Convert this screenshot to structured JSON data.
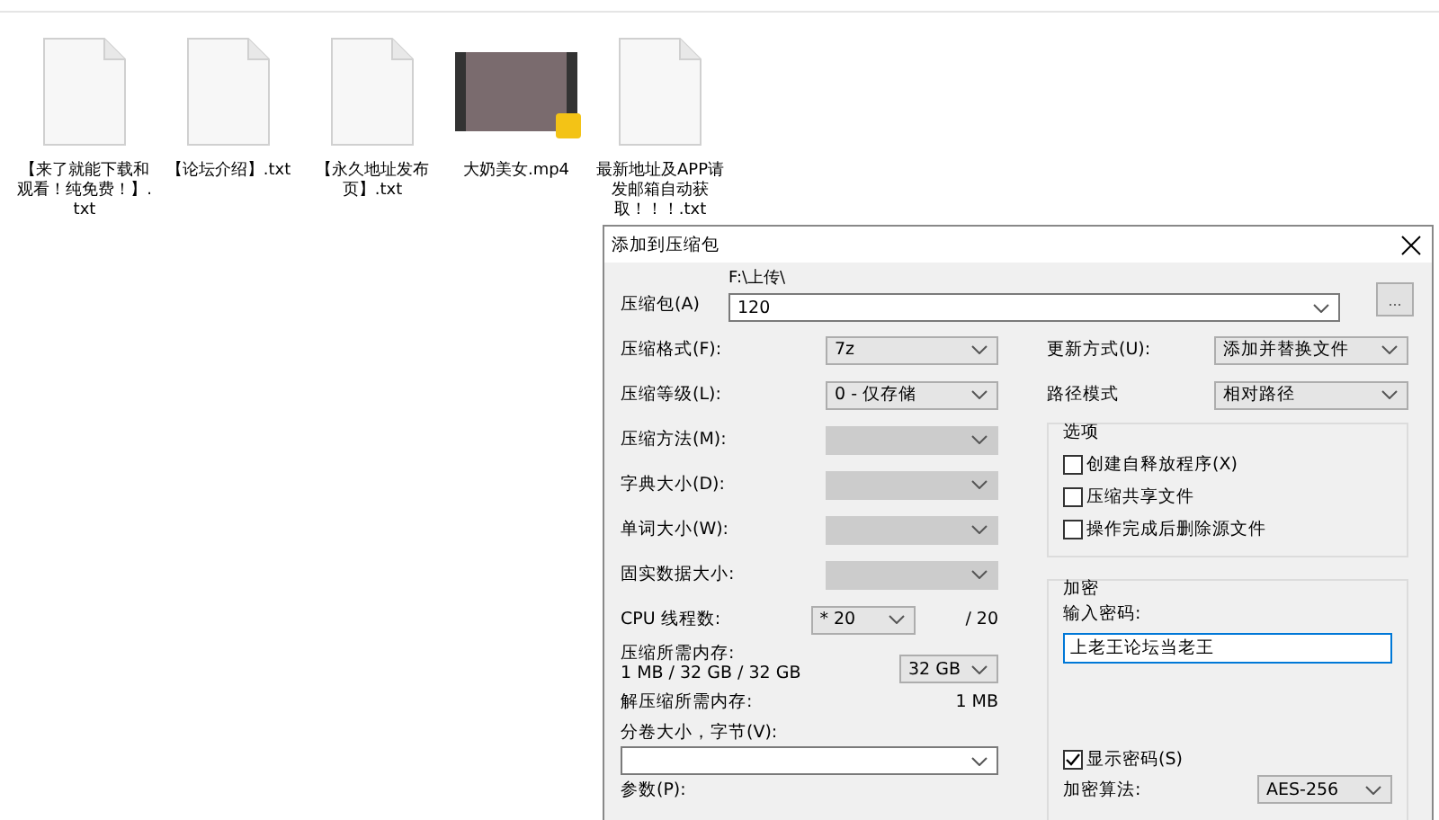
{
  "files": [
    {
      "name": "【来了就能下载和观看！纯免费！】.txt",
      "kind": "text"
    },
    {
      "name": "【论坛介绍】.txt",
      "kind": "text"
    },
    {
      "name": "【永久地址发布页】.txt",
      "kind": "text"
    },
    {
      "name": "大奶美女.mp4",
      "kind": "video"
    },
    {
      "name": "最新地址及APP请发邮箱自动获取！！！.txt",
      "kind": "text"
    }
  ],
  "dialog": {
    "title": "添加到压缩包",
    "archive": {
      "label": "压缩包(A)",
      "path": "F:\\上传\\",
      "value": "120",
      "browse": "..."
    },
    "left_rows": [
      {
        "label": "压缩格式(F):",
        "value": "7z",
        "disabled": false
      },
      {
        "label": "压缩等级(L):",
        "value": "0 - 仅存储",
        "disabled": false
      },
      {
        "label": "压缩方法(M):",
        "disabled": true
      },
      {
        "label": "字典大小(D):",
        "disabled": true
      },
      {
        "label": "单词大小(W):",
        "disabled": true
      },
      {
        "label": "固实数据大小:",
        "disabled": true
      }
    ],
    "cpu": {
      "label": "CPU 线程数:",
      "value": "* 20",
      "total": "/ 20"
    },
    "memory": {
      "label": "压缩所需内存:",
      "detail": "1 MB / 32 GB / 32 GB",
      "value": "32 GB"
    },
    "decompress": {
      "label": "解压缩所需内存:",
      "value": "1 MB"
    },
    "volume": {
      "label": "分卷大小，字节(V):"
    },
    "params": {
      "label": "参数(P):"
    },
    "right_rows": [
      {
        "label": "更新方式(U):",
        "value": "添加并替换文件"
      },
      {
        "label": "路径模式",
        "value": "相对路径"
      }
    ],
    "options": {
      "title": "选项",
      "items": [
        {
          "label": "创建自释放程序(X)",
          "checked": false
        },
        {
          "label": "压缩共享文件",
          "checked": false
        },
        {
          "label": "操作完成后删除源文件",
          "checked": false
        }
      ]
    },
    "encryption": {
      "title": "加密",
      "password_label": "输入密码:",
      "password": "上老王论坛当老王",
      "show_password": {
        "label": "显示密码(S)",
        "checked": true
      },
      "method_label": "加密算法:",
      "method": "AES-256"
    }
  }
}
